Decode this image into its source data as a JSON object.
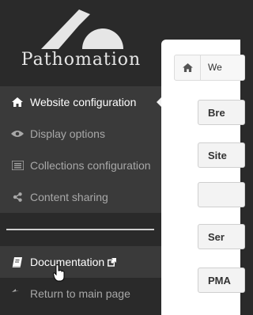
{
  "brand": {
    "name": "Pathomation"
  },
  "sidebar": {
    "items": [
      {
        "label": "Website configuration",
        "icon": "home-icon",
        "active": true
      },
      {
        "label": "Display options",
        "icon": "eye-icon",
        "active": false
      },
      {
        "label": "Collections configuration",
        "icon": "list-icon",
        "active": false
      },
      {
        "label": "Content sharing",
        "icon": "share-icon",
        "active": false
      }
    ],
    "bottom": [
      {
        "label": "Documentation",
        "icon": "book-icon",
        "external_icon": "external-link-icon"
      },
      {
        "label": "Return to main page",
        "icon": "return-icon"
      }
    ]
  },
  "content": {
    "breadcrumb": {
      "icon": "home-icon",
      "text": "We"
    },
    "fields": [
      {
        "label": "Bre"
      },
      {
        "label": "Site"
      },
      {
        "label": ""
      },
      {
        "label": "Ser"
      },
      {
        "label": "PMA"
      }
    ]
  },
  "colors": {
    "sidebar_bg": "#2a2a2a",
    "menu_bg": "#3a3a3a",
    "panel_bg": "#ffffff"
  }
}
